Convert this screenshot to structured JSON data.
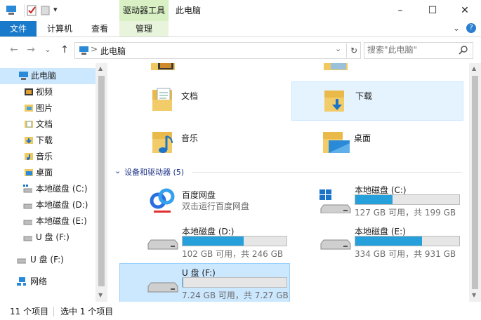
{
  "window": {
    "title": "此电脑",
    "ctx_tab_title": "驱动器工具",
    "controls": {
      "minimize": "–",
      "maximize": "☐",
      "close": "✕"
    }
  },
  "quick_access": {
    "dropdown": "▾"
  },
  "ribbon": {
    "tabs": [
      "文件",
      "计算机",
      "查看",
      "管理"
    ],
    "expand": "⌄",
    "help": "?"
  },
  "address": {
    "back": "←",
    "forward": "→",
    "recent": "⌄",
    "up": "↑",
    "separator": ">",
    "path": "此电脑",
    "dropdown": "⌄",
    "refresh": "↻"
  },
  "search": {
    "placeholder": "搜索\"此电脑\""
  },
  "nav": {
    "items": [
      {
        "label": "此电脑",
        "icon": "pc-icon",
        "selected": true
      },
      {
        "label": "视频",
        "icon": "video-folder-icon"
      },
      {
        "label": "图片",
        "icon": "pictures-folder-icon"
      },
      {
        "label": "文档",
        "icon": "documents-folder-icon"
      },
      {
        "label": "下载",
        "icon": "downloads-folder-icon"
      },
      {
        "label": "音乐",
        "icon": "music-folder-icon"
      },
      {
        "label": "桌面",
        "icon": "desktop-folder-icon"
      },
      {
        "label": "本地磁盘 (C:)",
        "icon": "windows-drive-icon"
      },
      {
        "label": "本地磁盘 (D:)",
        "icon": "drive-icon"
      },
      {
        "label": "本地磁盘 (E:)",
        "icon": "drive-icon"
      },
      {
        "label": "U 盘 (F:)",
        "icon": "usb-drive-icon"
      },
      {
        "label": "U 盘 (F:)",
        "icon": "usb-drive-icon"
      },
      {
        "label": "网络",
        "icon": "network-icon"
      }
    ]
  },
  "folders": [
    {
      "label": "文档",
      "icon": "documents-folder-icon"
    },
    {
      "label": "下载",
      "icon": "downloads-folder-icon",
      "hovered": true
    },
    {
      "label": "音乐",
      "icon": "music-folder-icon"
    },
    {
      "label": "桌面",
      "icon": "desktop-folder-icon"
    }
  ],
  "devices_group": {
    "title": "设备和驱动器 (5)",
    "chevron": "⌄"
  },
  "drives": [
    {
      "name": "百度网盘",
      "sub": "双击运行百度网盘",
      "icon": "baidu-netdisk-icon"
    },
    {
      "name": "本地磁盘 (C:)",
      "sub": "127 GB 可用，共 199 GB",
      "used_fraction": 0.36,
      "icon": "windows-drive-icon"
    },
    {
      "name": "本地磁盘 (D:)",
      "sub": "102 GB 可用，共 246 GB",
      "used_fraction": 0.59,
      "icon": "drive-icon"
    },
    {
      "name": "本地磁盘 (E:)",
      "sub": "334 GB 可用，共 931 GB",
      "used_fraction": 0.64,
      "icon": "drive-icon"
    },
    {
      "name": "U 盘 (F:)",
      "sub": "7.24 GB 可用，共 7.27 GB",
      "used_fraction": 0.004,
      "icon": "usb-drive-icon",
      "selected": true
    }
  ],
  "status": {
    "items_count": "11 个项目",
    "selected": "选中 1 个项目"
  },
  "colors": {
    "accent": "#1979ca",
    "bar_fill": "#26a0da",
    "selection": "#cce8ff",
    "context_tab": "#d8f0c4"
  }
}
